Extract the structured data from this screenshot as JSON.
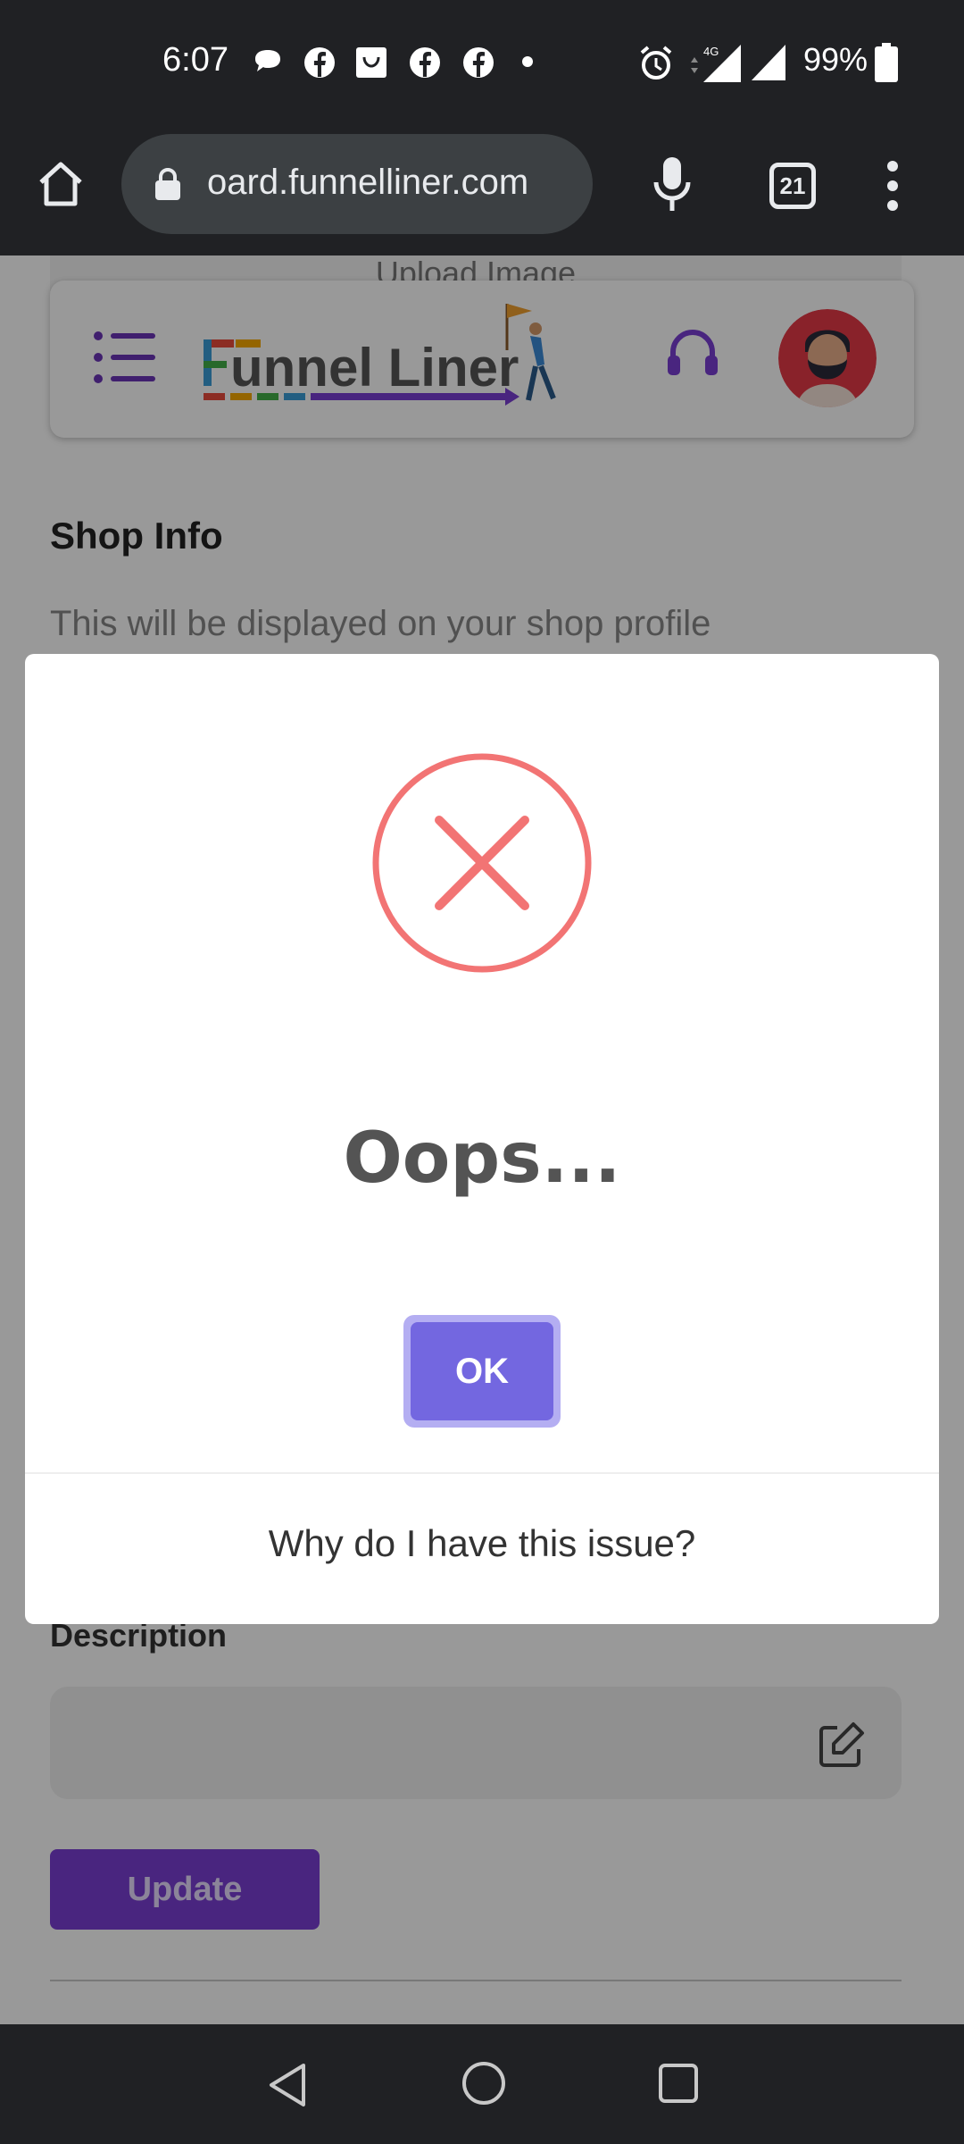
{
  "status_bar": {
    "time": "6:07",
    "battery_percent": "99%",
    "network_label": "4G"
  },
  "browser": {
    "url": "oard.funnelliner.com",
    "tab_count": "21"
  },
  "page": {
    "upload_image_label": "Upload Image",
    "logo_text": "FunnelLiner",
    "shop_info_title": "Shop Info",
    "shop_info_subtitle": "This will be displayed on your shop profile",
    "description_label": "Description",
    "update_label": "Update"
  },
  "modal": {
    "title": "Oops...",
    "ok_label": "OK",
    "footer_link": "Why do I have this issue?"
  },
  "colors": {
    "error_red": "#f27474",
    "ok_button": "#7367e0",
    "brand_purple": "#7b3fd4",
    "system_bar": "#202124"
  }
}
